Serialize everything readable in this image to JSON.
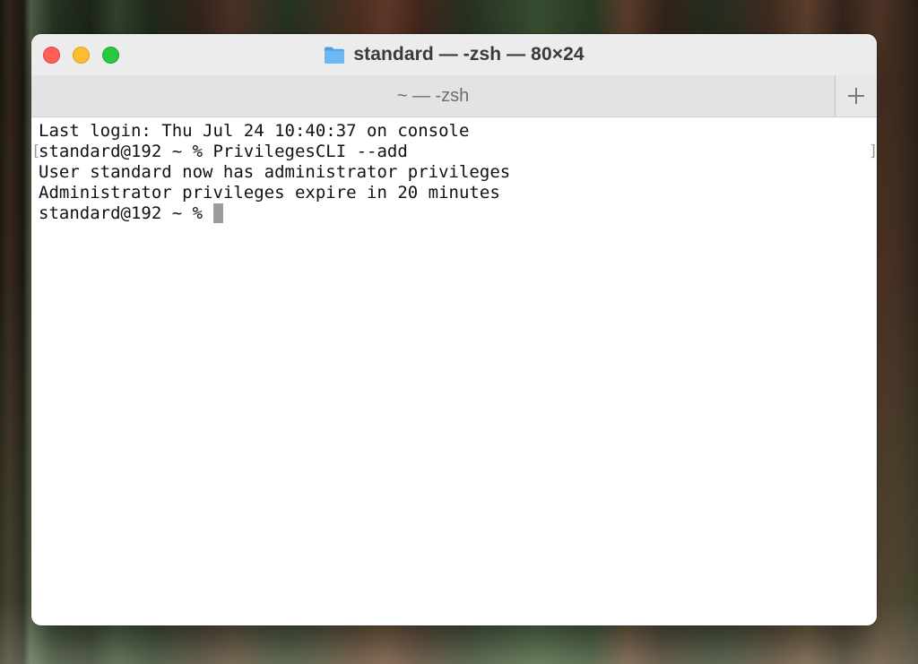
{
  "window": {
    "title": "standard — -zsh — 80×24",
    "title_icon": "folder-icon"
  },
  "tabs": [
    {
      "label": "~ — -zsh",
      "active": true
    }
  ],
  "new_tab_icon": "plus-icon",
  "terminal": {
    "lines": [
      "Last login: Thu Jul 24 10:40:37 on console",
      "standard@192 ~ % PrivilegesCLI --add",
      "User standard now has administrator privileges",
      "Administrator privileges expire in 20 minutes",
      "standard@192 ~ % "
    ],
    "mark_brackets": [
      "[",
      "]"
    ]
  },
  "colors": {
    "close": "#fe5f57",
    "minimize": "#febc2e",
    "zoom": "#28c840",
    "cursor": "#9c9c9c",
    "folder": "#5aa9e6"
  }
}
